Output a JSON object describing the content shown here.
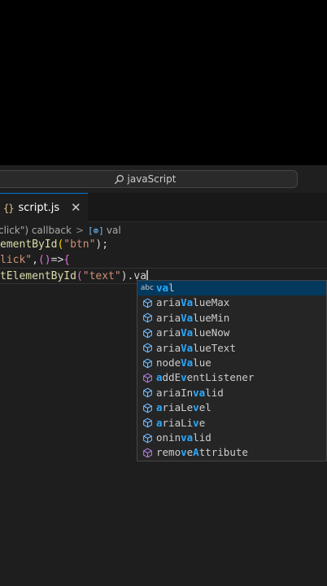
{
  "search": {
    "label": "javaScript"
  },
  "tab": {
    "icon_text": "{}",
    "label": "script.js",
    "close": "✕"
  },
  "breadcrumb": {
    "part1": "click\") callback",
    "sep": ">",
    "symbol_icon": "[⊚]",
    "part2": "val"
  },
  "code": {
    "line1": {
      "a": "ementById",
      "b": "(",
      "c": "\"btn\"",
      "d": ");"
    },
    "line2": {
      "a": "lick\"",
      "b": ",",
      "c": "()",
      "d": "=>",
      "e": "{"
    },
    "line3": {
      "a": "tElementById",
      "b": "(",
      "c": "\"text\"",
      "d": ").va"
    }
  },
  "suggestions": [
    {
      "kind": "text",
      "pre": "",
      "hl1": "va",
      "mid": "l",
      "hl2": "",
      "post": ""
    },
    {
      "kind": "property",
      "pre": "aria",
      "hl1": "Va",
      "mid": "lueMax",
      "hl2": "",
      "post": ""
    },
    {
      "kind": "property",
      "pre": "aria",
      "hl1": "Va",
      "mid": "lueMin",
      "hl2": "",
      "post": ""
    },
    {
      "kind": "property",
      "pre": "aria",
      "hl1": "Va",
      "mid": "lueNow",
      "hl2": "",
      "post": ""
    },
    {
      "kind": "property",
      "pre": "aria",
      "hl1": "Va",
      "mid": "lueText",
      "hl2": "",
      "post": ""
    },
    {
      "kind": "property",
      "pre": "node",
      "hl1": "Va",
      "mid": "lue",
      "hl2": "",
      "post": ""
    },
    {
      "kind": "method",
      "pre": "",
      "hl1": "a",
      "mid": "ddE",
      "hl2": "v",
      "post": "entListener"
    },
    {
      "kind": "property",
      "pre": "ariaIn",
      "hl1": "va",
      "mid": "lid",
      "hl2": "",
      "post": ""
    },
    {
      "kind": "property",
      "pre": "",
      "hl1": "a",
      "mid": "riaLe",
      "hl2": "v",
      "post": "el"
    },
    {
      "kind": "property",
      "pre": "",
      "hl1": "a",
      "mid": "riaLi",
      "hl2": "v",
      "post": "e"
    },
    {
      "kind": "property",
      "pre": "onin",
      "hl1": "va",
      "mid": "lid",
      "hl2": "",
      "post": ""
    },
    {
      "kind": "method",
      "pre": "remo",
      "hl1": "v",
      "mid": "e",
      "hl2": "A",
      "post": "ttribute"
    }
  ],
  "colors": {
    "accent": "#0078d4",
    "match": "#2aaaff",
    "property_icon": "#75beff",
    "method_icon": "#b180d7"
  }
}
